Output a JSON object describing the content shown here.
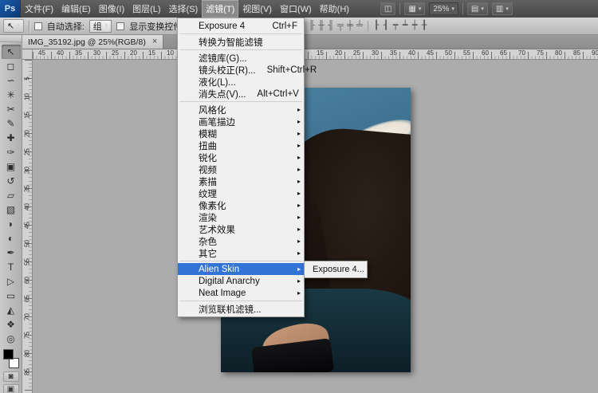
{
  "app": {
    "logo": "Ps"
  },
  "colors": {
    "highlight": "#3273d6",
    "menu-bg": "#f0f0f0",
    "canvas-bg": "#acacac",
    "logo-blue": "#0d4d90",
    "photo-wall": "#3c6f8d",
    "photo-hair": "#1b130e",
    "photo-skin": "#c79a7e"
  },
  "icons": {
    "dropdown_arrow": "▾",
    "submenu_arrow": "▸",
    "close": "×"
  },
  "menubar": {
    "items": [
      {
        "label": "文件(F)",
        "name": "menu-file"
      },
      {
        "label": "编辑(E)",
        "name": "menu-edit"
      },
      {
        "label": "图像(I)",
        "name": "menu-image"
      },
      {
        "label": "图层(L)",
        "name": "menu-layer"
      },
      {
        "label": "选择(S)",
        "name": "menu-select"
      },
      {
        "label": "滤镜(T)",
        "name": "menu-filter",
        "active": true
      },
      {
        "label": "视图(V)",
        "name": "menu-view"
      },
      {
        "label": "窗口(W)",
        "name": "menu-window"
      },
      {
        "label": "帮助(H)",
        "name": "menu-help"
      }
    ],
    "bridge_icon": "◫",
    "view_extras_icon": "▦",
    "zoom_value": "25%",
    "arrange_icon": "▤",
    "screen_icon": "▥"
  },
  "options_bar": {
    "tool_icon": "↖",
    "auto_select_label": "自动选择:",
    "auto_select_value": "组",
    "show_transform_label": "显示变换控件",
    "align_icons": [
      "╟",
      "╫",
      "╢",
      "╤",
      "╪",
      "╧"
    ],
    "distribute_icons": [
      "┠",
      "┨",
      "┯",
      "┷",
      "┿",
      "╂"
    ]
  },
  "tab": {
    "title": "IMG_35192.jpg @ 25%(RGB/8)"
  },
  "rulers": {
    "h_left": [
      "45",
      "40",
      "35",
      "30",
      "25",
      "20",
      "15",
      "10"
    ],
    "h_right": [
      "15",
      "20",
      "25",
      "30",
      "35",
      "40",
      "45",
      "50",
      "55",
      "60",
      "65",
      "70",
      "75",
      "80",
      "85",
      "90"
    ],
    "v": [
      "5",
      "10",
      "15",
      "20",
      "25",
      "30",
      "35",
      "40",
      "45",
      "50",
      "55",
      "60",
      "65",
      "70",
      "75",
      "80",
      "85"
    ]
  },
  "toolbar": {
    "tools": [
      {
        "name": "move-tool",
        "glyph": "↖",
        "active": true
      },
      {
        "name": "rectangular-marquee-tool",
        "glyph": "◻"
      },
      {
        "name": "lasso-tool",
        "glyph": "∽"
      },
      {
        "name": "quick-selection-tool",
        "glyph": "✳"
      },
      {
        "name": "crop-tool",
        "glyph": "✂"
      },
      {
        "name": "eyedropper-tool",
        "glyph": "✎"
      },
      {
        "name": "spot-healing-brush-tool",
        "glyph": "✚"
      },
      {
        "name": "brush-tool",
        "glyph": "✑"
      },
      {
        "name": "clone-stamp-tool",
        "glyph": "▣"
      },
      {
        "name": "history-brush-tool",
        "glyph": "↺"
      },
      {
        "name": "eraser-tool",
        "glyph": "▱"
      },
      {
        "name": "gradient-tool",
        "glyph": "▧"
      },
      {
        "name": "blur-tool",
        "glyph": "◗"
      },
      {
        "name": "dodge-tool",
        "glyph": "◐"
      },
      {
        "name": "pen-tool",
        "glyph": "✒"
      },
      {
        "name": "type-tool",
        "glyph": "T"
      },
      {
        "name": "path-selection-tool",
        "glyph": "▷"
      },
      {
        "name": "rectangle-tool",
        "glyph": "▭"
      },
      {
        "name": "3d-rotate-tool",
        "glyph": "◭"
      },
      {
        "name": "hand-tool",
        "glyph": "❖"
      },
      {
        "name": "zoom-tool",
        "glyph": "◎"
      }
    ],
    "quick_mask_icon": "◙",
    "screen_mode_icon": "▣"
  },
  "filter_menu": {
    "items": [
      {
        "label": "Exposure 4",
        "shortcut": "Ctrl+F",
        "name": "menu-item-exposure-4"
      },
      {
        "type": "separator",
        "name": "menu-separator"
      },
      {
        "label": "转换为智能滤镜",
        "name": "menu-item-convert-smart-filters"
      },
      {
        "type": "separator",
        "name": "menu-separator"
      },
      {
        "label": "滤镜库(G)...",
        "name": "menu-item-filter-gallery"
      },
      {
        "label": "镜头校正(R)...",
        "shortcut": "Shift+Ctrl+R",
        "name": "menu-item-lens-correction"
      },
      {
        "label": "液化(L)...",
        "name": "menu-item-liquify"
      },
      {
        "label": "消失点(V)...",
        "shortcut": "Alt+Ctrl+V",
        "name": "menu-item-vanishing-point"
      },
      {
        "type": "separator",
        "name": "menu-separator"
      },
      {
        "label": "风格化",
        "submenu": true,
        "name": "menu-item-stylize"
      },
      {
        "label": "画笔描边",
        "submenu": true,
        "name": "menu-item-brush-strokes"
      },
      {
        "label": "模糊",
        "submenu": true,
        "name": "menu-item-blur"
      },
      {
        "label": "扭曲",
        "submenu": true,
        "name": "menu-item-distort"
      },
      {
        "label": "锐化",
        "submenu": true,
        "name": "menu-item-sharpen"
      },
      {
        "label": "视频",
        "submenu": true,
        "name": "menu-item-video"
      },
      {
        "label": "素描",
        "submenu": true,
        "name": "menu-item-sketch"
      },
      {
        "label": "纹理",
        "submenu": true,
        "name": "menu-item-texture"
      },
      {
        "label": "像素化",
        "submenu": true,
        "name": "menu-item-pixelate"
      },
      {
        "label": "渲染",
        "submenu": true,
        "name": "menu-item-render"
      },
      {
        "label": "艺术效果",
        "submenu": true,
        "name": "menu-item-artistic"
      },
      {
        "label": "杂色",
        "submenu": true,
        "name": "menu-item-noise"
      },
      {
        "label": "其它",
        "submenu": true,
        "name": "menu-item-other"
      },
      {
        "type": "separator",
        "name": "menu-separator"
      },
      {
        "label": "Alien Skin",
        "submenu": true,
        "active": true,
        "name": "menu-item-alien-skin"
      },
      {
        "label": "Digital Anarchy",
        "submenu": true,
        "name": "menu-item-digital-anarchy"
      },
      {
        "label": "Neat Image",
        "submenu": true,
        "name": "menu-item-neat-image"
      },
      {
        "type": "separator",
        "name": "menu-separator"
      },
      {
        "label": "浏览联机滤镜...",
        "name": "menu-item-browse-filters-online"
      }
    ]
  },
  "alien_skin_submenu": {
    "items": [
      {
        "label": "Exposure 4...",
        "name": "submenu-item-exposure-4"
      }
    ]
  }
}
